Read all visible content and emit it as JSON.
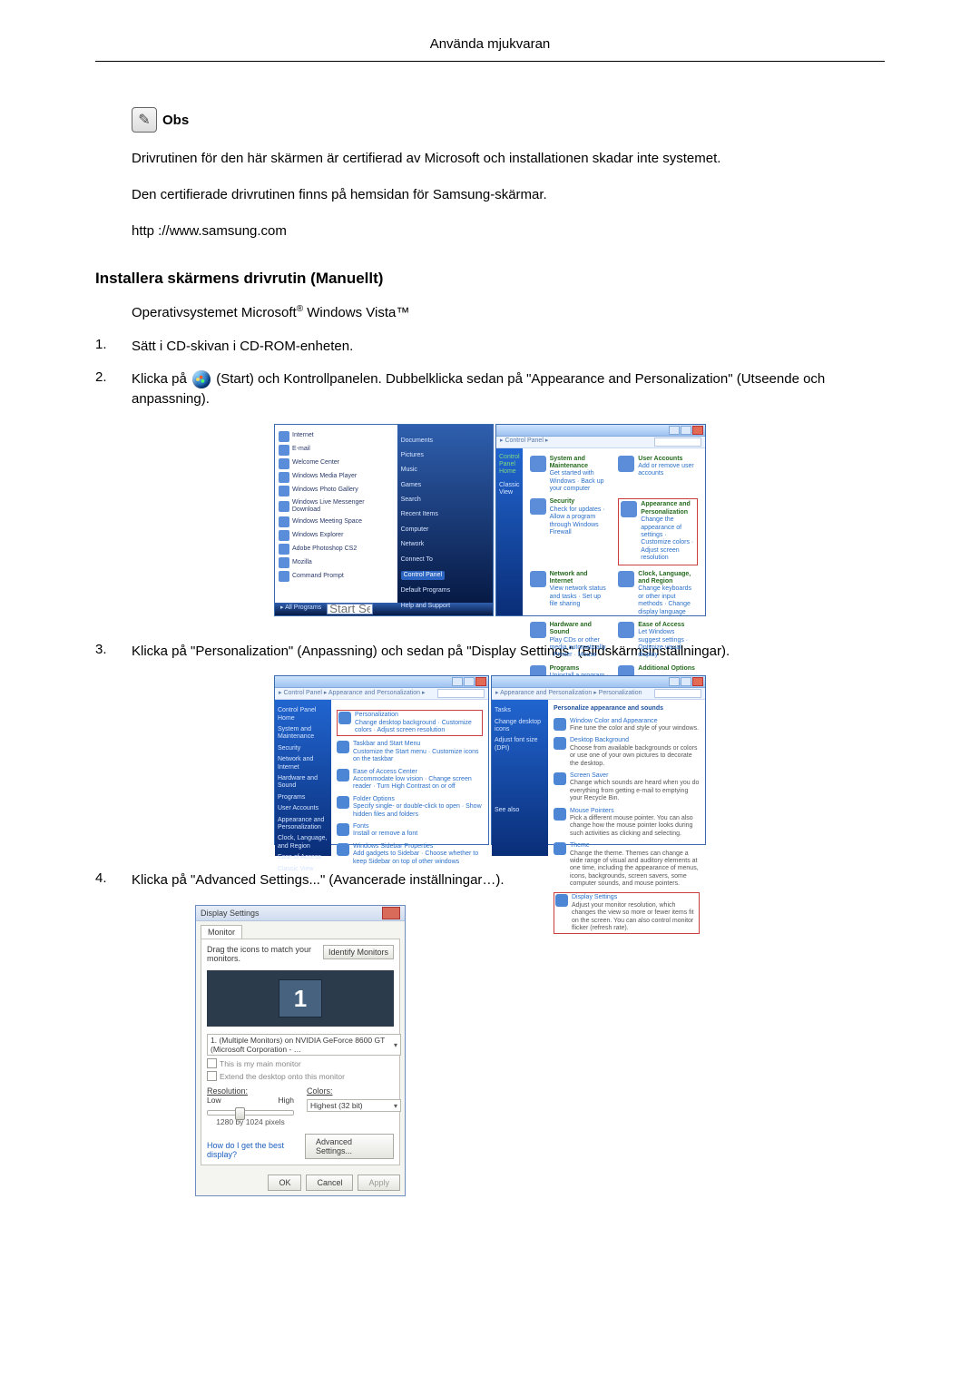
{
  "header": {
    "title": "Använda mjukvaran"
  },
  "note": {
    "label": "Obs",
    "p1": "Drivrutinen för den här skärmen är certifierad av Microsoft och installationen skadar inte systemet.",
    "p2": "Den certifierade drivrutinen finns på hemsidan för Samsung-skärmar.",
    "url": "http ://www.samsung.com"
  },
  "section": {
    "title": "Installera skärmens drivrutin (Manuellt)",
    "os_prefix": "Operativsystemet Microsoft",
    "os_suffix": " Windows Vista™",
    "reg": "®"
  },
  "steps": {
    "s1": {
      "num": "1.",
      "text": "Sätt i CD-skivan i CD-ROM-enheten."
    },
    "s2": {
      "num": "2.",
      "pre": "Klicka på ",
      "post": " (Start) och Kontrollpanelen. Dubbelklicka sedan på \"Appearance and Personalization\" (Utseende och anpassning)."
    },
    "s3": {
      "num": "3.",
      "text": "Klicka på \"Personalization\" (Anpassning) och sedan på \"Display Settings\" (Bildskärmsinställningar)."
    },
    "s4": {
      "num": "4.",
      "text": "Klicka på \"Advanced Settings...\" (Avancerade inställningar…)."
    }
  },
  "fig1": {
    "start_items_left": [
      "Internet",
      "E-mail",
      "Welcome Center",
      "Windows Media Player",
      "Windows Photo Gallery",
      "Windows Live Messenger Download",
      "Windows Meeting Space",
      "Windows Explorer",
      "Adobe Photoshop CS2",
      "Mozilla",
      "Command Prompt"
    ],
    "all_programs": "All Programs",
    "start_search": "Start Search",
    "right_items": [
      "Documents",
      "Pictures",
      "Music",
      "Games",
      "Search",
      "Recent Items",
      "Computer",
      "Network",
      "Connect To",
      "Control Panel",
      "Default Programs",
      "Help and Support"
    ],
    "right_highlight": "Control Panel",
    "cp_addr": "▸ Control Panel ▸",
    "cp_items": [
      {
        "t": "System and Maintenance",
        "d": "Get started with Windows · Back up your computer"
      },
      {
        "t": "User Accounts",
        "d": "Add or remove user accounts"
      },
      {
        "t": "Security",
        "d": "Check for updates · Allow a program through Windows Firewall"
      },
      {
        "t": "Appearance and Personalization",
        "d": "Change the appearance of settings · Customize colors · Adjust screen resolution",
        "hl": true
      },
      {
        "t": "Network and Internet",
        "d": "View network status and tasks · Set up file sharing"
      },
      {
        "t": "Clock, Language, and Region",
        "d": "Change keyboards or other input methods · Change display language"
      },
      {
        "t": "Hardware and Sound",
        "d": "Play CDs or other media automatically · Printer · Mouse"
      },
      {
        "t": "Ease of Access",
        "d": "Let Windows suggest settings · Optimize visual display"
      },
      {
        "t": "Programs",
        "d": "Uninstall a program · Change startup programs"
      },
      {
        "t": "Additional Options",
        "d": ""
      }
    ],
    "classic_view": "Classic View",
    "cp_home": "Control Panel Home"
  },
  "fig2": {
    "left_addr": "▸ Control Panel ▸ Appearance and Personalization ▸",
    "right_addr": "▸ Appearance and Personalization ▸ Personalization",
    "side_items": [
      "Control Panel Home",
      "System and Maintenance",
      "Security",
      "Network and Internet",
      "Hardware and Sound",
      "Programs",
      "User Accounts",
      "Appearance and Personalization",
      "Clock, Language, and Region",
      "Ease of Access",
      "Classic View"
    ],
    "left_rows": [
      {
        "t": "Personalization",
        "d": "Change desktop background · Customize colors · Adjust screen resolution",
        "hl": true
      },
      {
        "t": "Taskbar and Start Menu",
        "d": "Customize the Start menu · Customize icons on the taskbar"
      },
      {
        "t": "Ease of Access Center",
        "d": "Accommodate low vision · Change screen reader · Turn High Contrast on or off"
      },
      {
        "t": "Folder Options",
        "d": "Specify single- or double-click to open · Show hidden files and folders"
      },
      {
        "t": "Fonts",
        "d": "Install or remove a font"
      },
      {
        "t": "Windows Sidebar Properties",
        "d": "Add gadgets to Sidebar · Choose whether to keep Sidebar on top of other windows"
      }
    ],
    "right_side": [
      "Tasks",
      "Change desktop icons",
      "Adjust font size (DPI)"
    ],
    "right_title": "Personalize appearance and sounds",
    "right_rows": [
      {
        "t": "Window Color and Appearance",
        "d": "Fine tune the color and style of your windows."
      },
      {
        "t": "Desktop Background",
        "d": "Choose from available backgrounds or colors or use one of your own pictures to decorate the desktop."
      },
      {
        "t": "Screen Saver",
        "d": "Change which sounds are heard when you do everything from getting e-mail to emptying your Recycle Bin."
      },
      {
        "t": "Mouse Pointers",
        "d": "Pick a different mouse pointer. You can also change how the mouse pointer looks during such activities as clicking and selecting."
      },
      {
        "t": "Theme",
        "d": "Change the theme. Themes can change a wide range of visual and auditory elements at one time, including the appearance of menus, icons, backgrounds, screen savers, some computer sounds, and mouse pointers."
      },
      {
        "t": "Display Settings",
        "d": "Adjust your monitor resolution, which changes the view so more or fewer items fit on the screen. You can also control monitor flicker (refresh rate).",
        "hl": true
      }
    ],
    "see_also": "See also"
  },
  "fig3": {
    "title": "Display Settings",
    "tab": "Monitor",
    "drag": "Drag the icons to match your monitors.",
    "identify": "Identify Monitors",
    "monitor_num": "1",
    "combo": "1. (Multiple Monitors) on NVIDIA GeForce 8600 GT (Microsoft Corporation - …",
    "chk1": "This is my main monitor",
    "chk2": "Extend the desktop onto this monitor",
    "res_label": "Resolution:",
    "low": "Low",
    "high": "High",
    "res_val": "1280 by 1024 pixels",
    "colors_label": "Colors:",
    "colors_val": "Highest (32 bit)",
    "help": "How do I get the best display?",
    "adv": "Advanced Settings...",
    "ok": "OK",
    "cancel": "Cancel",
    "apply": "Apply"
  }
}
